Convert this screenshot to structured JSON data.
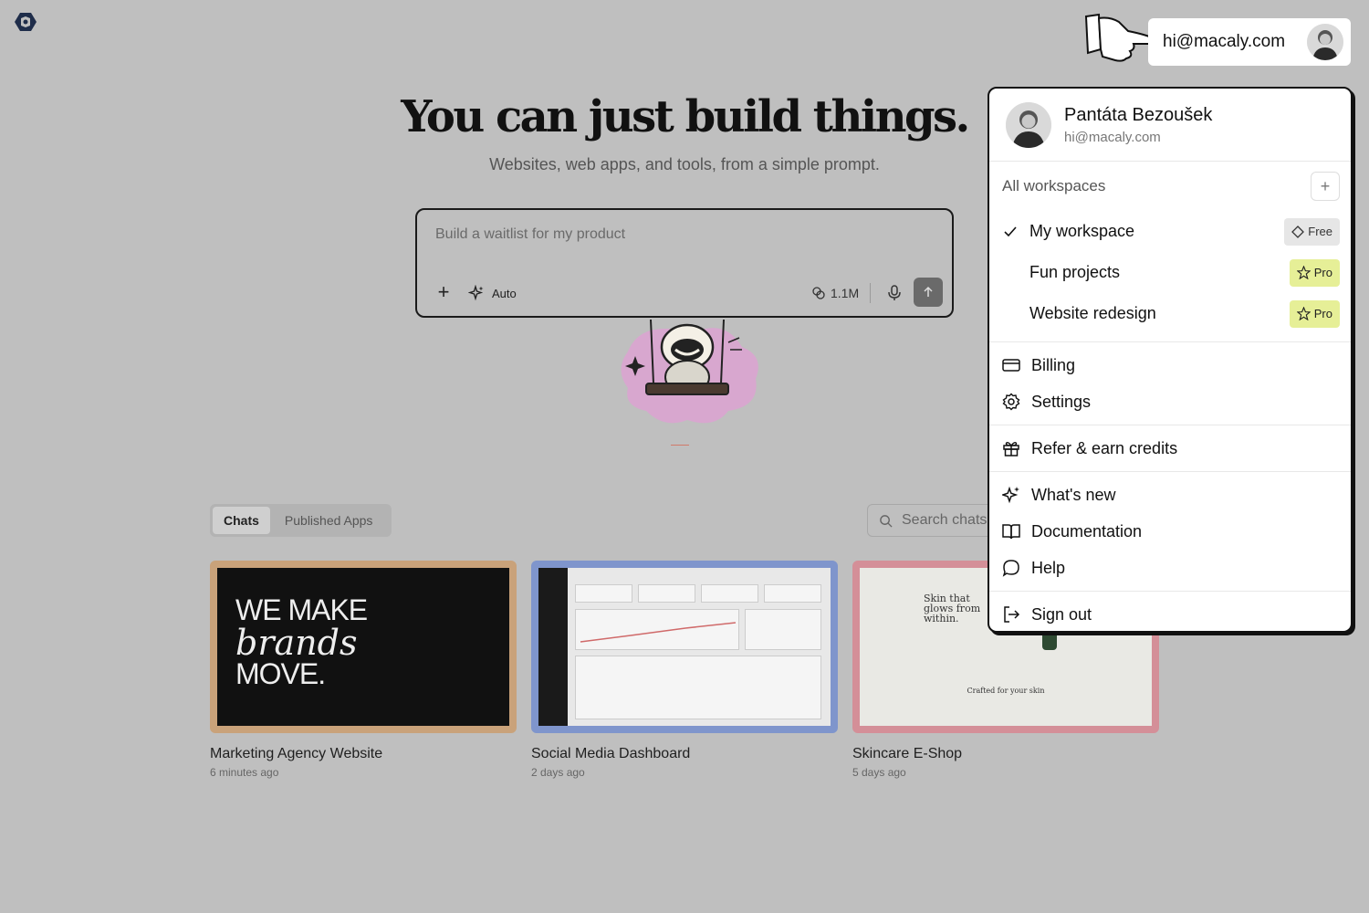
{
  "app": {
    "logo_icon": "hexagon-logo-icon"
  },
  "hero": {
    "title": "You can just build things.",
    "subtitle": "Websites, web apps, and tools, from a simple prompt."
  },
  "prompt": {
    "placeholder": "Build a waitlist for my product",
    "add_icon": "plus-icon",
    "mode_label": "Auto",
    "mode_icon": "sparkle-icon",
    "tokens_label": "1.1M",
    "tokens_icon": "tokens-icon",
    "mic_icon": "microphone-icon",
    "send_icon": "arrow-up-icon"
  },
  "tabs": [
    {
      "label": "Chats",
      "active": true
    },
    {
      "label": "Published Apps",
      "active": false
    }
  ],
  "search": {
    "placeholder": "Search chats..."
  },
  "projects": [
    {
      "title": "Marketing Agency Website",
      "time": "6 minutes ago",
      "border": "#c9a27a",
      "thumb_text_1": "WE MAKE",
      "thumb_text_2": "brands",
      "thumb_text_3": "MOVE."
    },
    {
      "title": "Social Media Dashboard",
      "time": "2 days ago",
      "border": "#7f95cc"
    },
    {
      "title": "Skincare E-Shop",
      "time": "5 days ago",
      "border": "#d48f98",
      "thumb_text_1": "Skin that glows from within.",
      "thumb_text_2": "Crafted for your skin"
    }
  ],
  "user": {
    "email": "hi@macaly.com",
    "name": "Pantáta Bezoušek"
  },
  "menu": {
    "workspaces_label": "All workspaces",
    "workspaces": [
      {
        "name": "My workspace",
        "selected": true,
        "plan": "Free"
      },
      {
        "name": "Fun projects",
        "selected": false,
        "plan": "Pro"
      },
      {
        "name": "Website redesign",
        "selected": false,
        "plan": "Pro"
      }
    ],
    "items": {
      "billing": {
        "label": "Billing",
        "icon": "credit-card-icon"
      },
      "settings": {
        "label": "Settings",
        "icon": "gear-icon"
      },
      "refer": {
        "label": "Refer & earn credits",
        "icon": "gift-icon"
      },
      "whats_new": {
        "label": "What's new",
        "icon": "sparkle-icon"
      },
      "docs": {
        "label": "Documentation",
        "icon": "book-icon"
      },
      "help": {
        "label": "Help",
        "icon": "chat-bubble-icon"
      },
      "signout": {
        "label": "Sign out",
        "icon": "sign-out-icon"
      }
    }
  },
  "colors": {
    "background": "#bfbfbf",
    "pro_badge": "#e6ef97",
    "free_badge": "#e6e6e6"
  }
}
